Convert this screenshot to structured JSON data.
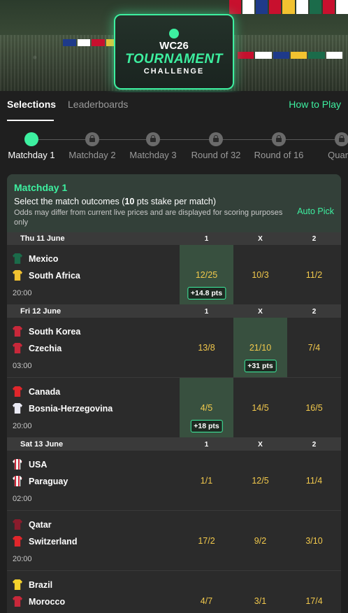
{
  "hero": {
    "logo_line1": "WC26",
    "logo_line2": "TOURNAMENT",
    "logo_line3": "CHALLENGE"
  },
  "tabs": {
    "selections": "Selections",
    "leaderboards": "Leaderboards",
    "how_to_play": "How to Play"
  },
  "steps": [
    {
      "label": "Matchday 1",
      "state": "active"
    },
    {
      "label": "Matchday 2",
      "state": "locked"
    },
    {
      "label": "Matchday 3",
      "state": "locked"
    },
    {
      "label": "Round of 32",
      "state": "locked"
    },
    {
      "label": "Round of 16",
      "state": "locked"
    },
    {
      "label": "Quarte",
      "state": "locked"
    }
  ],
  "card": {
    "title": "Matchday 1",
    "desc_prefix": "Select the match outcomes (",
    "desc_bold": "10",
    "desc_suffix": " pts stake per match)",
    "note": "Odds may differ from current live prices and are displayed for scoring purposes only",
    "auto_pick": "Auto Pick"
  },
  "colors": {
    "accent": "#3df0a0",
    "odds": "#f2c94c",
    "selected_bg": "#38503f"
  },
  "days": [
    {
      "date": "Thu 11 June",
      "h1": "1",
      "hx": "X",
      "h2": "2",
      "matches": [
        {
          "home": "Mexico",
          "away": "South Africa",
          "time": "20:00",
          "home_shirt": "#1b6b4a",
          "away_shirt": "#f2c230",
          "odd1": "12/25",
          "oddx": "10/3",
          "odd2": "11/2",
          "pts1": "+14.8 pts"
        }
      ]
    },
    {
      "date": "Fri 12 June",
      "h1": "1",
      "hx": "X",
      "h2": "2",
      "matches": [
        {
          "home": "South Korea",
          "away": "Czechia",
          "time": "03:00",
          "home_shirt": "#c8283a",
          "away_shirt": "#c8283a",
          "odd1": "13/8",
          "oddx": "21/10",
          "odd2": "7/4",
          "ptsx": "+31 pts"
        },
        {
          "home": "Canada",
          "away": "Bosnia-Herzegovina",
          "time": "20:00",
          "home_shirt": "#e0262b",
          "away_shirt": "#eaeaf5",
          "odd1": "4/5",
          "oddx": "14/5",
          "odd2": "16/5",
          "pts1": "+18 pts"
        }
      ]
    },
    {
      "date": "Sat 13 June",
      "h1": "1",
      "hx": "X",
      "h2": "2",
      "matches": [
        {
          "home": "USA",
          "away": "Paraguay",
          "time": "02:00",
          "home_shirt": "#f4f4f4",
          "away_shirt": "#e8e0e0",
          "odd1": "1/1",
          "oddx": "12/5",
          "odd2": "11/4"
        },
        {
          "home": "Qatar",
          "away": "Switzerland",
          "time": "20:00",
          "home_shirt": "#8a1c2c",
          "away_shirt": "#e0262b",
          "odd1": "17/2",
          "oddx": "9/2",
          "odd2": "3/10"
        },
        {
          "home": "Brazil",
          "away": "Morocco",
          "time": "",
          "home_shirt": "#f6d32c",
          "away_shirt": "#c8283a",
          "odd1": "4/7",
          "oddx": "3/1",
          "odd2": "17/4"
        }
      ]
    }
  ]
}
